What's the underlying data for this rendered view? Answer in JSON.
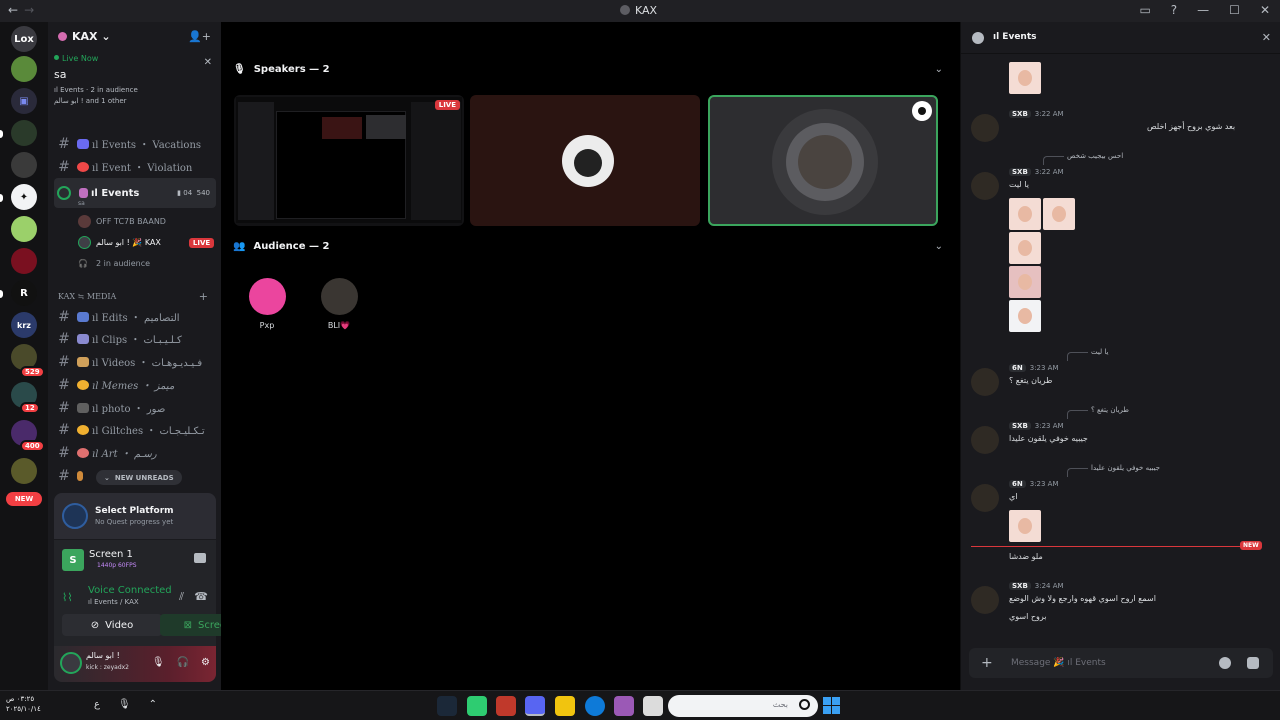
{
  "titlebar": {
    "back": "←",
    "forward": "→",
    "title": "KAX"
  },
  "rail": {
    "servers": [
      {
        "label": "Lox",
        "color": "#2b3aa0"
      },
      {
        "label": "",
        "color": "#5a8a3a"
      },
      {
        "label": "",
        "color": "#2a2a5a"
      },
      {
        "label": "",
        "color": "#3a3a3a"
      },
      {
        "label": "",
        "color": "#3a3a3a"
      },
      {
        "label": "",
        "color": "#f2f3f5"
      },
      {
        "label": "",
        "color": "#9bd06a"
      },
      {
        "label": "",
        "color": "#7a1020"
      },
      {
        "label": "R",
        "color": "#111"
      },
      {
        "label": "krz",
        "color": "#2b3a6a"
      }
    ],
    "badges": [
      "529",
      "12",
      "400"
    ],
    "new_label": "NEW"
  },
  "sidebar": {
    "server_name": "KAX",
    "live": {
      "status": "Live Now",
      "title": "sa",
      "channel": "ıl Events · 2 in audience",
      "people": "ابو سالم ! and 1 other"
    },
    "channels": [
      {
        "name": "ıl Events ・ Vacations",
        "emoji_color": "#6a6af0"
      },
      {
        "name": "ıl Event ・ Violation",
        "emoji_color": "#f04848"
      }
    ],
    "active_channel": {
      "name": "ıl Events",
      "count_a": "04",
      "count_b": "540",
      "topic": "sa"
    },
    "voice_members": [
      {
        "name": "OFF TC7B BAAND",
        "live": false
      },
      {
        "name": "ابو سالم ! 🎉 KAX",
        "live": true
      }
    ],
    "audience_label": "2 in audience",
    "live_badge": "LIVE",
    "category": "KAX ≒ MEDIA",
    "media_channels": [
      {
        "name": "ıl Edits ・ التصاميم",
        "emoji_color": "#5a7ad0"
      },
      {
        "name": "ıl Clips ・ كـلـيـبـات",
        "emoji_color": "#8a8ad0"
      },
      {
        "name": "ıl Videos ・ فـيـديـوهـات",
        "emoji_color": "#d0a05a"
      },
      {
        "name": "ıl Memes ・ ميمز",
        "emoji_color": "#f0b030"
      },
      {
        "name": "ıl photo ・ صور",
        "emoji_color": "#606060"
      },
      {
        "name": "ıl Giltches ・ تـكـليـجـات",
        "emoji_color": "#f0b030"
      },
      {
        "name": "ıl Art ・ رسـم",
        "emoji_color": "#e07070"
      }
    ],
    "new_unreads": "NEW UNREADS",
    "quest": {
      "title": "Select Platform",
      "sub": "No Quest progress yet"
    },
    "screen": {
      "title": "Screen 1",
      "sub": "1440p 60FPS"
    },
    "voice": {
      "status": "Voice Connected",
      "channel": "ıl Events / KAX",
      "video_label": "Video",
      "screen_label": "Screen"
    },
    "user": {
      "name": "ابو سالم !",
      "status": "kick : zeyadx2"
    }
  },
  "main": {
    "speakers_title": "Speakers — 2",
    "live_tag": "LIVE",
    "audience_title": "Audience — 2",
    "audience": [
      {
        "name": "Pxp",
        "color": "#eb459e"
      },
      {
        "name": "BLI💗",
        "color": "#3a3632"
      }
    ]
  },
  "chat": {
    "title": "ıl Events",
    "messages": [
      {
        "tag": "SXB",
        "time": "3:22 AM",
        "body": "بعد شوي بروح أجهز اخلص"
      },
      {
        "reply": "احس بيجيب شخص",
        "tag": "SXB",
        "time": "3:22 AM",
        "body": "يا ليت"
      },
      {
        "reply": "يا ليت",
        "tag": "6N",
        "time": "3:23 AM",
        "body": "طريان يتغع ؟"
      },
      {
        "reply": "طريان يتغع ؟",
        "tag": "SXB",
        "time": "3:23 AM",
        "body": "جيبيه خوفي يلقون عليدا"
      },
      {
        "reply": "جيبيه خوفي يلقون عليدا",
        "tag": "6N",
        "time": "3:23 AM",
        "body": "اي"
      },
      {
        "body": "ملو ضدشا"
      },
      {
        "tag": "SXB",
        "time": "3:24 AM",
        "body": "اسمع اروح اسوي قهوه وارجع ولا وش الوضع",
        "body2": "بروح اسوي"
      }
    ],
    "new_tag": "NEW",
    "composer_placeholder": "Message 🎉 ıl Events"
  },
  "taskbar": {
    "clock": "٠٣:٢٥ ص",
    "date": "٢٠٢٥/١٠/١٤",
    "lang": "ع",
    "search_placeholder": "بحث"
  }
}
